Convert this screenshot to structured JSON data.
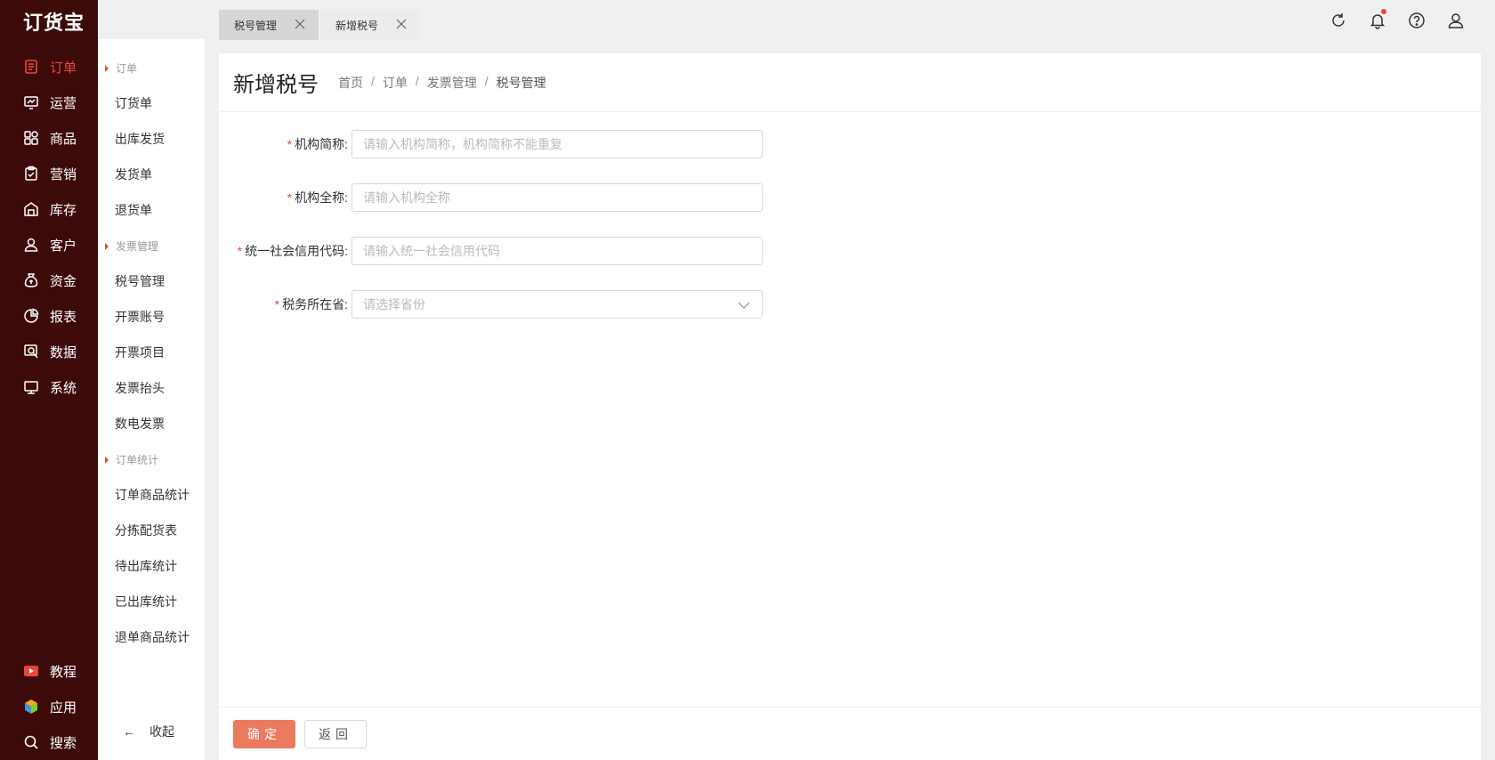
{
  "app": {
    "logo": "订货宝"
  },
  "sidebar": {
    "items": [
      {
        "label": "订单",
        "icon": "order-icon",
        "active": true
      },
      {
        "label": "运营",
        "icon": "operation-icon"
      },
      {
        "label": "商品",
        "icon": "product-icon"
      },
      {
        "label": "营销",
        "icon": "marketing-icon"
      },
      {
        "label": "库存",
        "icon": "inventory-icon"
      },
      {
        "label": "客户",
        "icon": "customer-icon"
      },
      {
        "label": "资金",
        "icon": "funds-icon"
      },
      {
        "label": "报表",
        "icon": "report-icon"
      },
      {
        "label": "数据",
        "icon": "data-icon"
      },
      {
        "label": "系统",
        "icon": "system-icon"
      }
    ],
    "bottom": [
      {
        "label": "教程",
        "icon": "tutorial-icon"
      },
      {
        "label": "应用",
        "icon": "apps-icon"
      },
      {
        "label": "搜索",
        "icon": "search-icon"
      }
    ],
    "accent": "#e8473b",
    "background": "#3d0a0a"
  },
  "submenu": {
    "groups": [
      {
        "title": "订单",
        "items": [
          "订货单",
          "出库发货",
          "发货单",
          "退货单"
        ]
      },
      {
        "title": "发票管理",
        "items": [
          "税号管理",
          "开票账号",
          "开票项目",
          "发票抬头",
          "数电发票"
        ]
      },
      {
        "title": "订单统计",
        "items": [
          "订单商品统计",
          "分拣配货表",
          "待出库统计",
          "已出库统计",
          "退单商品统计"
        ]
      }
    ],
    "collapse_label": "收起"
  },
  "tabs": [
    {
      "label": "税号管理"
    },
    {
      "label": "新增税号"
    }
  ],
  "header_icons": [
    "refresh-icon",
    "bell-icon",
    "help-icon",
    "user-icon"
  ],
  "page": {
    "title": "新增税号",
    "breadcrumb": [
      "首页",
      "订单",
      "发票管理",
      "税号管理"
    ]
  },
  "form": {
    "fields": [
      {
        "label": "机构简称:",
        "placeholder": "请输入机构简称，机构简称不能重复",
        "required": true
      },
      {
        "label": "机构全称:",
        "placeholder": "请输入机构全称",
        "required": true
      },
      {
        "label": "统一社会信用代码:",
        "placeholder": "请输入统一社会信用代码",
        "required": true
      },
      {
        "label": "税务所在省:",
        "placeholder": "请选择省份",
        "required": true,
        "type": "select"
      }
    ],
    "required_mark": "*"
  },
  "actions": {
    "confirm": "确定",
    "back": "返回"
  }
}
